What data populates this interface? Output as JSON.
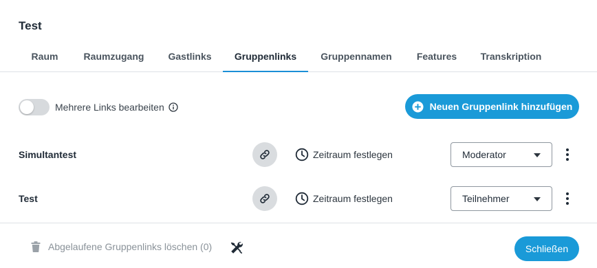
{
  "dialog": {
    "title": "Test"
  },
  "tabs": [
    {
      "label": "Raum",
      "active": false
    },
    {
      "label": "Raumzugang",
      "active": false
    },
    {
      "label": "Gastlinks",
      "active": false
    },
    {
      "label": "Gruppenlinks",
      "active": true
    },
    {
      "label": "Gruppennamen",
      "active": false
    },
    {
      "label": "Features",
      "active": false
    },
    {
      "label": "Transkription",
      "active": false
    }
  ],
  "toolbar": {
    "toggle_label": "Mehrere Links bearbeiten",
    "toggle_on": false,
    "add_button_label": "Neuen Gruppenlink hinzufügen"
  },
  "rows": [
    {
      "name": "Simultantest",
      "time_label": "Zeitraum festlegen",
      "role": "Moderator"
    },
    {
      "name": "Test",
      "time_label": "Zeitraum festlegen",
      "role": "Teilnehmer"
    }
  ],
  "footer": {
    "delete_label": "Abgelaufene Gruppenlinks löschen (0)",
    "close_label": "Schließen"
  },
  "colors": {
    "accent": "#1a9ad8",
    "tab_underline": "#1a8fd6",
    "link_button_bg": "#d9dcdf"
  },
  "icons": [
    "info-icon",
    "plus-circle-icon",
    "link-icon",
    "clock-icon",
    "caret-down-icon",
    "kebab-icon",
    "trash-icon",
    "tools-icon"
  ]
}
